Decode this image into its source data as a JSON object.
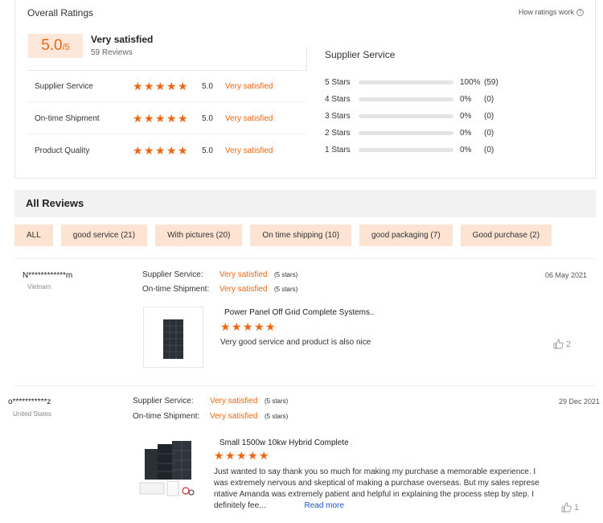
{
  "overall": {
    "title": "Overall Ratings",
    "how_link": "How ratings work",
    "score": "5.0",
    "score_den": "/5",
    "label": "Very satisfied",
    "review_count": "59 Reviews",
    "categories": [
      {
        "label": "Supplier Service",
        "score": "5.0",
        "text": "Very satisfied"
      },
      {
        "label": "On-time Shipment",
        "score": "5.0",
        "text": "Very satisfied"
      },
      {
        "label": "Product Quality",
        "score": "5.0",
        "text": "Very satisfied"
      }
    ]
  },
  "distribution": {
    "title": "Supplier Service",
    "rows": [
      {
        "label": "5 Stars",
        "fraction": 1.0,
        "pct": "100%",
        "count": "(59)"
      },
      {
        "label": "4 Stars",
        "fraction": 0,
        "pct": "0%",
        "count": "(0)"
      },
      {
        "label": "3 Stars",
        "fraction": 0,
        "pct": "0%",
        "count": "(0)"
      },
      {
        "label": "2 Stars",
        "fraction": 0,
        "pct": "0%",
        "count": "(0)"
      },
      {
        "label": "1 Stars",
        "fraction": 0,
        "pct": "0%",
        "count": "(0)"
      }
    ]
  },
  "all_reviews": {
    "title": "All Reviews",
    "filters": [
      "ALL",
      "good service (21)",
      "With pictures (20)",
      "On time shipping (10)",
      "good packaging (7)",
      "Good purchase (2)"
    ]
  },
  "reviews": [
    {
      "user": "N************m",
      "country": "Vietnam",
      "supplier_key": "Supplier Service:",
      "supplier_val": "Very satisfied",
      "supplier_sub": "(5 stars)",
      "shipment_key": "On-time Shipment:",
      "shipment_val": "Very satisfied",
      "shipment_sub": "(5 stars)",
      "date": "06 May 2021",
      "product": "Power Panel Off Grid Complete Systems..",
      "rating": 5,
      "text": "Very good service and product is also nice",
      "likes": "2"
    },
    {
      "user": "o***********z",
      "country": "United States",
      "supplier_key": "Supplier Service:",
      "supplier_val": "Very satisfied",
      "supplier_sub": "(5 stars)",
      "shipment_key": "On-time Shipment:",
      "shipment_val": "Very satisfied",
      "shipment_sub": "(5 stars)",
      "date": "29 Dec 2021",
      "product": "Small 1500w 10kw Hybrid Complete",
      "rating": 5,
      "text_lines": [
        "Just wanted to say thank you so much for making my purchase a memorable experience. I",
        "was extremely nervous and skeptical of making a purchase overseas.  But my sales represe",
        "ntative Amanda was extremely patient and helpful in explaining the process step by step.  I",
        "definitely fee..."
      ],
      "read_more": "Read more",
      "likes": "1"
    }
  ],
  "colors": {
    "accent": "#f0640f",
    "chip_bg": "#fde3d2",
    "link": "#1a56c7"
  }
}
